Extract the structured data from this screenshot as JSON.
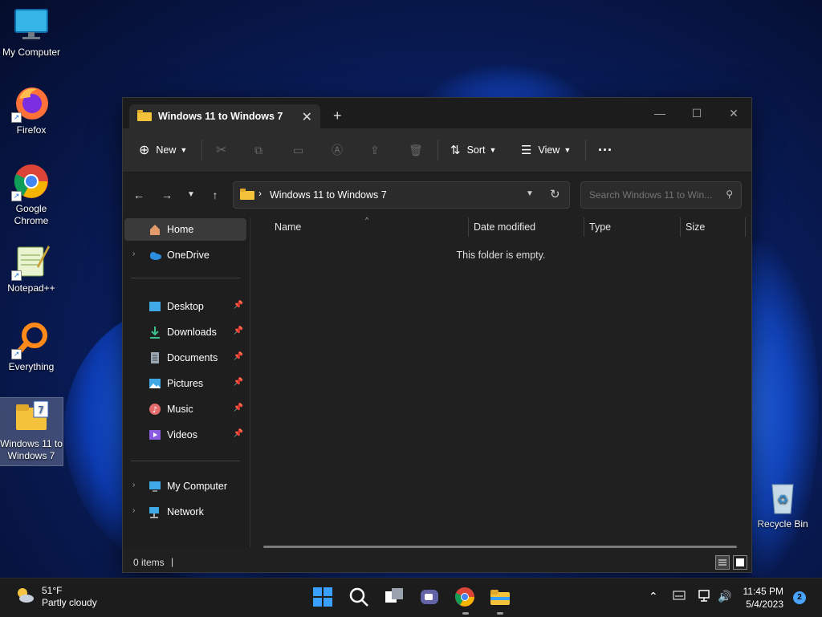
{
  "desktop": {
    "icons": [
      {
        "label": "My Computer"
      },
      {
        "label": "Firefox"
      },
      {
        "label": "Google Chrome"
      },
      {
        "label": "Notepad++"
      },
      {
        "label": "Everything"
      },
      {
        "label": "Windows 11 to Windows 7"
      },
      {
        "label": "Recycle Bin"
      }
    ]
  },
  "window": {
    "tab_title": "Windows 11 to Windows 7",
    "toolbar": {
      "new_label": "New",
      "sort_label": "Sort",
      "view_label": "View"
    },
    "address": {
      "crumb": "Windows 11 to Windows 7",
      "search_placeholder": "Search Windows 11 to Win..."
    },
    "sidebar": {
      "items": [
        {
          "label": "Home"
        },
        {
          "label": "OneDrive"
        },
        {
          "label": "Desktop"
        },
        {
          "label": "Downloads"
        },
        {
          "label": "Documents"
        },
        {
          "label": "Pictures"
        },
        {
          "label": "Music"
        },
        {
          "label": "Videos"
        },
        {
          "label": "My Computer"
        },
        {
          "label": "Network"
        }
      ]
    },
    "columns": [
      "Name",
      "Date modified",
      "Type",
      "Size"
    ],
    "empty_message": "This folder is empty.",
    "status": "0 items"
  },
  "taskbar": {
    "weather": {
      "temp": "51°F",
      "condition": "Partly cloudy"
    },
    "clock": {
      "time": "11:45 PM",
      "date": "5/4/2023"
    },
    "notification_count": "2"
  },
  "colors": {
    "accent": "#4aa3ff",
    "window_bg": "#202020",
    "toolbar_bg": "#2c2c2c",
    "folder_yellow": "#f5c33b"
  }
}
